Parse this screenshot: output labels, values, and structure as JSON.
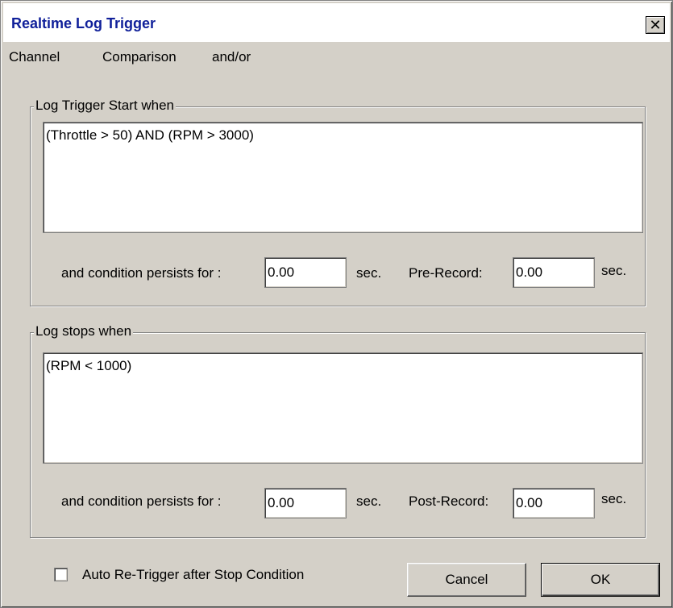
{
  "window": {
    "title": "Realtime Log Trigger",
    "close_glyph": "✕"
  },
  "menu": {
    "items": [
      "Channel",
      "Comparison",
      "and/or"
    ]
  },
  "start_group": {
    "label": "Log Trigger Start when",
    "condition": "(Throttle > 50) AND (RPM > 3000)",
    "persist_label": "and condition persists for :",
    "persist_value": "0.00",
    "persist_unit": "sec.",
    "record_label": "Pre-Record:",
    "record_value": "0.00",
    "record_unit": "sec."
  },
  "stop_group": {
    "label": "Log stops when",
    "condition": "(RPM < 1000)",
    "persist_label": "and condition persists for :",
    "persist_value": "0.00",
    "persist_unit": "sec.",
    "record_label": "Post-Record:",
    "record_value": "0.00",
    "record_unit": "sec."
  },
  "options": {
    "auto_retrigger_label": "Auto Re-Trigger after Stop Condition",
    "auto_retrigger_checked": false
  },
  "buttons": {
    "cancel": "Cancel",
    "ok": "OK"
  }
}
